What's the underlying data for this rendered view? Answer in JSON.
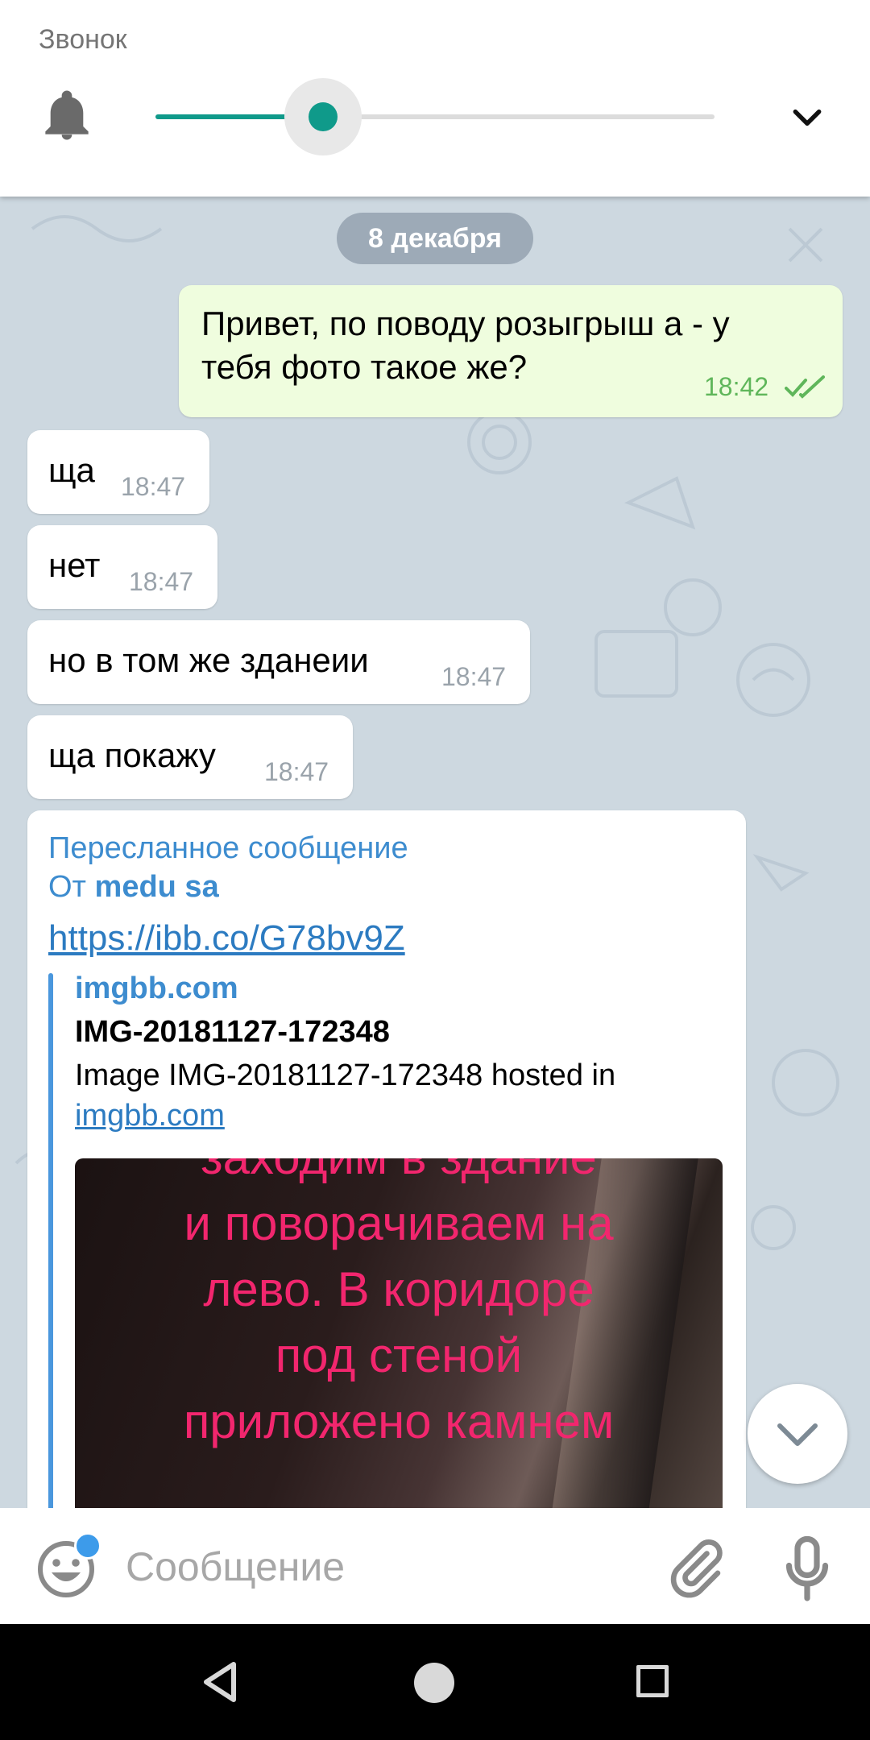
{
  "volume_panel": {
    "label": "Звонок",
    "level": 0.3,
    "icons": {
      "bell": "bell-icon",
      "expand": "chevron-down-icon"
    },
    "accent_color": "#0f9a8a"
  },
  "chat": {
    "date": "8 декабря",
    "messages": [
      {
        "direction": "out",
        "text_line1": "Привет, по поводу розыгрыш а - у",
        "text_line2": "тебя фото такое же?",
        "time": "18:42",
        "status": "read"
      },
      {
        "direction": "in",
        "text": "ща",
        "time": "18:47"
      },
      {
        "direction": "in",
        "text": "нет",
        "time": "18:47"
      },
      {
        "direction": "in",
        "text": "но в том же зданеии",
        "time": "18:47"
      },
      {
        "direction": "in",
        "text": "ща покажу",
        "time": "18:47"
      }
    ],
    "forwarded": {
      "header": "Пересланное сообщение",
      "from_prefix": "От",
      "from_name": "medu sa",
      "link": "https://ibb.co/G78bv9Z",
      "preview": {
        "site": "imgbb.com",
        "title": "IMG-20181127-172348",
        "description": "Image IMG-20181127-172348 hosted in",
        "description_link": "imgbb.com",
        "image_text": [
          "заходим в здание",
          "и поворачиваем на",
          "лево.  В коридоре",
          "под стеной",
          "приложено камнем"
        ]
      }
    }
  },
  "input_bar": {
    "placeholder": "Сообщение",
    "icons": {
      "emoji": "emoji-icon",
      "attach": "paperclip-icon",
      "mic": "microphone-icon"
    }
  },
  "nav_bar": {
    "icons": [
      "back-icon",
      "home-icon",
      "recents-icon"
    ]
  }
}
